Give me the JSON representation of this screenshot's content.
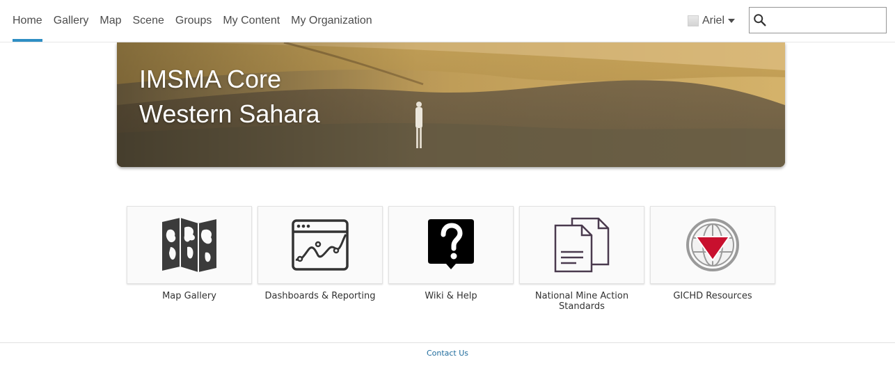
{
  "nav": {
    "items": [
      {
        "label": "Home",
        "active": true
      },
      {
        "label": "Gallery"
      },
      {
        "label": "Map"
      },
      {
        "label": "Scene"
      },
      {
        "label": "Groups"
      },
      {
        "label": "My Content"
      },
      {
        "label": "My Organization"
      }
    ],
    "accent_color": "#2e8ec4"
  },
  "user": {
    "name": "Ariel",
    "avatar_icon": "user-avatar-icon"
  },
  "search": {
    "value": "",
    "placeholder": "",
    "icon": "search-icon"
  },
  "banner": {
    "title_line1": "IMSMA Core",
    "title_line2": "Western Sahara"
  },
  "tiles": [
    {
      "label": "Map Gallery",
      "icon": "folded-map-icon"
    },
    {
      "label": "Dashboards & Reporting",
      "icon": "dashboard-chart-icon"
    },
    {
      "label": "Wiki & Help",
      "icon": "help-question-icon"
    },
    {
      "label": "National Mine Action Standards",
      "icon": "documents-icon"
    },
    {
      "label": "GICHD Resources",
      "icon": "gichd-globe-icon"
    }
  ],
  "footer": {
    "contact_label": "Contact Us",
    "link_color": "#1e6b9c"
  }
}
